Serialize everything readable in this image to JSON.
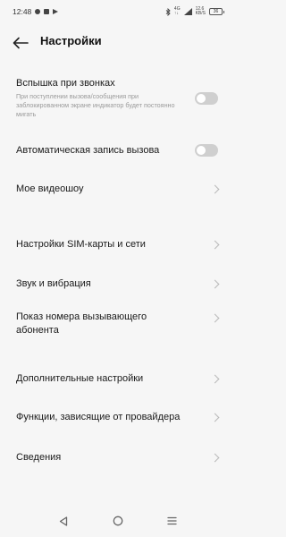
{
  "status_bar": {
    "time": "12:48",
    "network_top": "4G",
    "network_bottom": "↑↓",
    "network2_top": "12.6",
    "network2_bottom": "KB/S",
    "battery": "36"
  },
  "header": {
    "title": "Настройки",
    "back_icon": "arrow-left-icon"
  },
  "settings": {
    "flash": {
      "title": "Вспышка при звонках",
      "subtitle": "При поступлении вызова/сообщения при заблокированном экране индикатор будет постоянно мигать",
      "enabled": false
    },
    "auto_record": {
      "title": "Автоматическая запись вызова",
      "enabled": false
    },
    "video_show": {
      "title": "Мое видеошоу"
    },
    "sim": {
      "title": "Настройки SIM-карты и сети"
    },
    "sound": {
      "title": "Звук и вибрация"
    },
    "caller_id": {
      "title": "Показ номера вызывающего абонента"
    },
    "additional": {
      "title": "Дополнительные настройки"
    },
    "carrier": {
      "title": "Функции, зависящие от провайдера"
    },
    "about": {
      "title": "Сведения"
    }
  },
  "nav_bar": {
    "back_icon": "triangle-back-icon",
    "home_icon": "circle-home-icon",
    "menu_icon": "lines-menu-icon"
  }
}
